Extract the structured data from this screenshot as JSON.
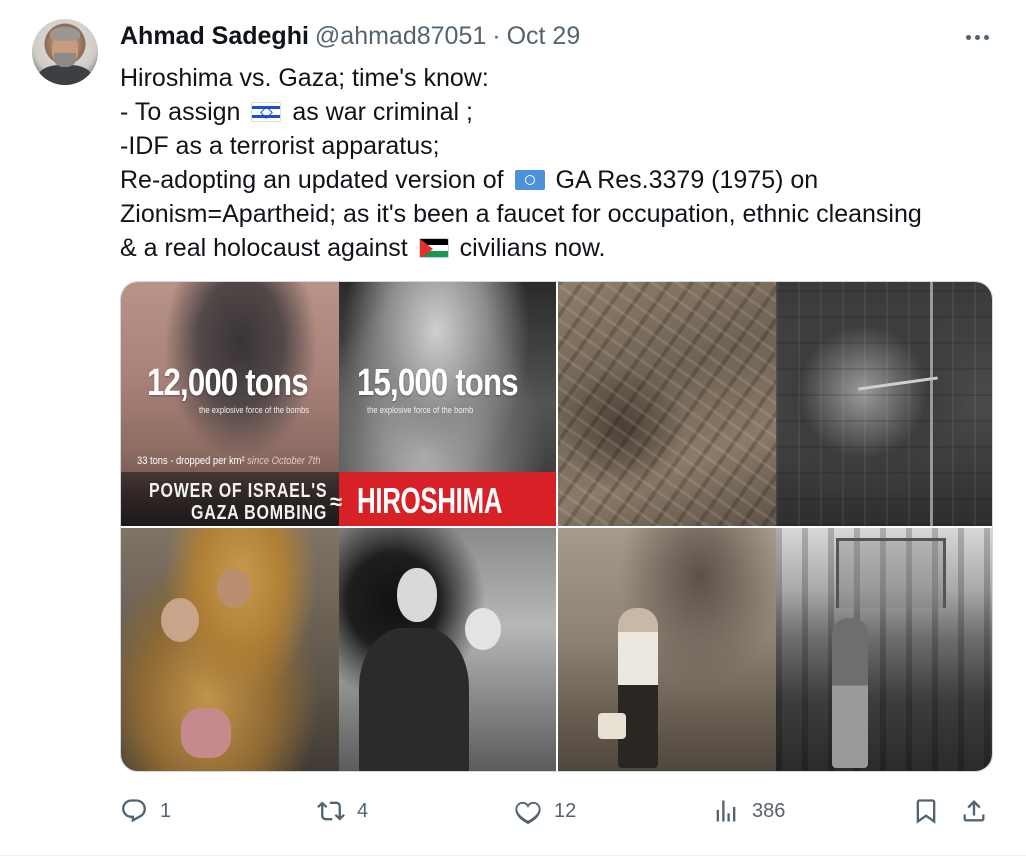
{
  "author": {
    "name": "Ahmad Sadeghi",
    "handle": "@ahmad87051",
    "separator": "·",
    "date": "Oct 29"
  },
  "tweet": {
    "line1": "Hiroshima vs. Gaza; time's know:",
    "line2_before": "- To assign",
    "line2_after": "as war criminal ;",
    "line3": "-IDF as a terrorist apparatus;",
    "line4_before": "Re-adopting an updated version of",
    "line4_after": "GA Res.3379 (1975) on",
    "line5": "Zionism=Apartheid; as it's been a faucet for occupation, ethnic cleansing",
    "line6_before": "& a real holocaust against",
    "line6_after": "civilians now.",
    "flags": [
      "israel-flag-icon",
      "un-flag-icon",
      "palestine-flag-icon"
    ]
  },
  "media": {
    "image1": {
      "gaza_tons": "12,000 tons",
      "gaza_sub": "the explosive force of the bombs",
      "hiroshima_tons": "15,000 tons",
      "hiroshima_sub": "the explosive force of the bomb",
      "stat": "33 tons - dropped per km²",
      "stat_since": "since October 7th",
      "caption_line1": "POWER OF ISRAEL'S",
      "caption_line2": "GAZA BOMBING",
      "approx": "≈",
      "hiroshima": "HIROSHIMA",
      "red": "#d82027"
    }
  },
  "actions": {
    "reply_count": "1",
    "retweet_count": "4",
    "like_count": "12",
    "views_count": "386"
  },
  "colors": {
    "text": "#0f1419",
    "secondary": "#536471",
    "border": "#cfd9de"
  }
}
